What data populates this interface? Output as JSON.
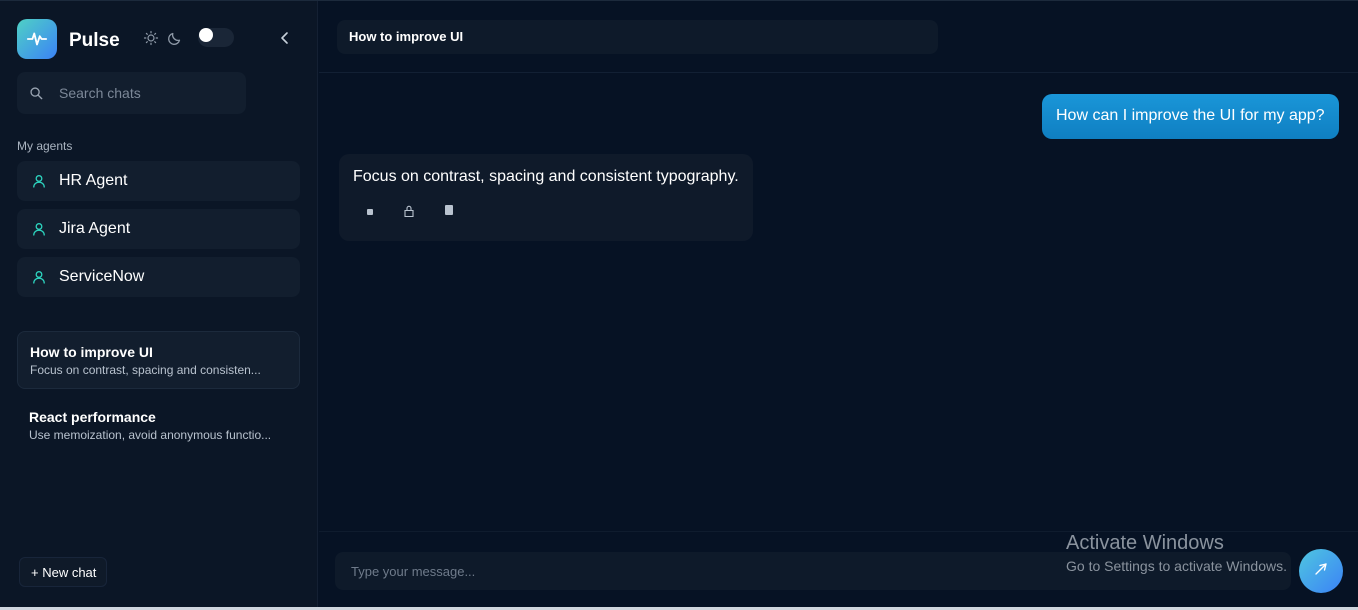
{
  "brand": {
    "name": "Pulse",
    "logo_icon": "pulse-wave-icon",
    "accent_gradient": [
      "#4fd1c5",
      "#3b82f6"
    ]
  },
  "header_controls": {
    "sun_icon": "sun-icon",
    "moon_icon": "moon-icon",
    "theme_toggle": "off",
    "collapse_icon": "chevron-left-icon"
  },
  "search": {
    "placeholder": "Search chats",
    "icon": "search-icon"
  },
  "agents": {
    "section_title": "My agents",
    "items": [
      {
        "label": "HR Agent",
        "icon": "user-icon"
      },
      {
        "label": "Jira Agent",
        "icon": "user-icon"
      },
      {
        "label": "ServiceNow",
        "icon": "user-icon"
      }
    ],
    "icon_color": "#2dd4bf"
  },
  "chats": [
    {
      "title": "How to improve UI",
      "preview": "Focus on contrast, spacing and consisten...",
      "active": true
    },
    {
      "title": "React performance",
      "preview": "Use memoization, avoid anonymous functio...",
      "active": false
    }
  ],
  "new_chat_label": "+ New chat",
  "conversation": {
    "title": "How to improve UI",
    "messages": [
      {
        "role": "user",
        "text": "How can I improve the UI for my app?"
      },
      {
        "role": "assistant",
        "text": "Focus on contrast, spacing and consistent typography.",
        "actions": [
          "stop-icon",
          "thumbs-up-icon",
          "copy-icon"
        ]
      }
    ]
  },
  "composer": {
    "placeholder": "Type your message...",
    "send_icon": "send-icon"
  },
  "watermark": {
    "title": "Activate Windows",
    "subtitle": "Go to Settings to activate Windows."
  },
  "colors": {
    "user_bubble": "#1a96d8",
    "background": "#061224",
    "sidebar": "#0b1626"
  }
}
